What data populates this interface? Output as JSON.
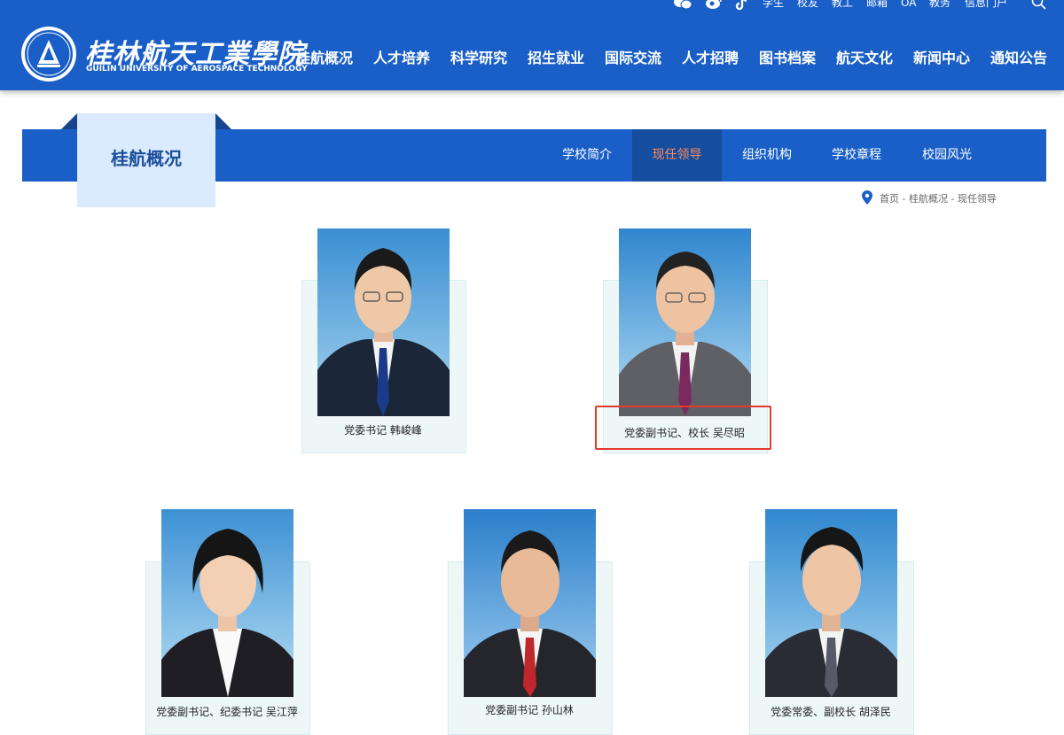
{
  "header": {
    "school_name_cn": "桂林航天工業學院",
    "school_name_en": "GUILIN UNIVERSITY OF AEROSPACE TECHNOLOGY",
    "utility_links": [
      "学生",
      "校友",
      "教工",
      "邮箱",
      "OA",
      "教务",
      "信息门户"
    ],
    "social_icons": [
      "wechat-icon",
      "weibo-icon",
      "tiktok-icon"
    ],
    "nav": [
      "桂航概况",
      "人才培养",
      "科学研究",
      "招生就业",
      "国际交流",
      "人才招聘",
      "图书档案",
      "航天文化",
      "新闻中心",
      "通知公告"
    ]
  },
  "section": {
    "title": "桂航概况",
    "subnav": [
      "学校简介",
      "现任领导",
      "组织机构",
      "学校章程",
      "校园风光"
    ],
    "active": "现任领导"
  },
  "breadcrumb": "首页 - 桂航概况 - 现任领导",
  "leaders": [
    {
      "caption": "党委书记 韩峻峰"
    },
    {
      "caption": "党委副书记、校长 吴尽昭"
    },
    {
      "caption": "党委副书记、纪委书记 吴江萍"
    },
    {
      "caption": "党委副书记 孙山林"
    },
    {
      "caption": "党委常委、副校长 胡泽民"
    }
  ],
  "colors": {
    "brand_blue": "#1a5fc7",
    "active_subnav_text": "#ff8b5a",
    "highlight_box": "#e23a2e"
  }
}
